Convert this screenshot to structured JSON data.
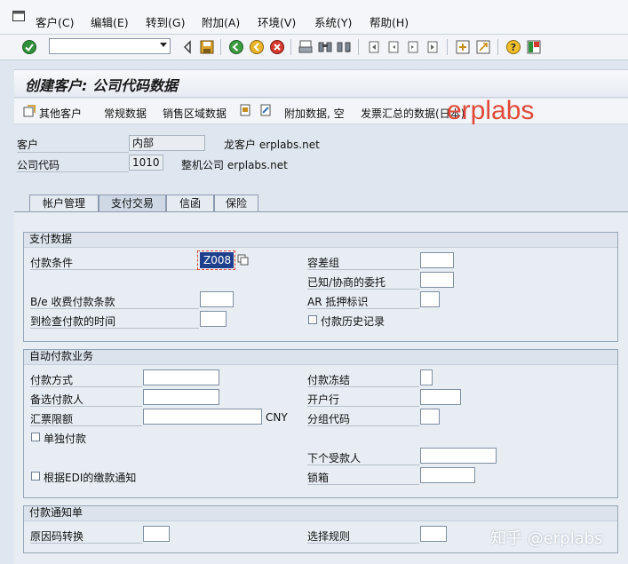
{
  "menubar": {
    "items": [
      "客户(C)",
      "编辑(E)",
      "转到(G)",
      "附加(A)",
      "环境(V)",
      "系统(Y)",
      "帮助(H)"
    ]
  },
  "screen": {
    "title": "创建客户: 公司代码数据"
  },
  "app_toolbar": {
    "other_customer": "其他客户",
    "general_data": "常规数据",
    "sales_area_data": "销售区域数据",
    "additional_data": "附加数据, 空",
    "invoice_summary": "发票汇总的数据(日本)"
  },
  "header": {
    "customer_label": "客户",
    "customer_value": "内部",
    "customer_desc": "龙客户 erplabs.net",
    "company_code_label": "公司代码",
    "company_code_value": "1010",
    "company_desc": "整机公司 erplabs.net"
  },
  "tabs": [
    "帐户管理",
    "支付交易",
    "信函",
    "保险"
  ],
  "payment_data": {
    "group_title": "支付数据",
    "payment_terms_label": "付款条件",
    "payment_terms_value": "Z008",
    "be_terms_label": "B/e 收费付款条款",
    "check_time_label": "到检查付款的时间",
    "tolerance_group_label": "容差组",
    "known_neg_leave_label": "已知/协商的委托",
    "ar_pledging_label": "AR 抵押标识",
    "payment_history_label": "付款历史记录"
  },
  "auto_payment": {
    "group_title": "自动付款业务",
    "payment_methods_label": "付款方式",
    "alt_payer_label": "备选付款人",
    "exchange_limit_label": "汇票限额",
    "currency": "CNY",
    "single_payment_label": "单独付款",
    "edi_advice_label": "根据EDI的缴款通知",
    "payment_block_label": "付款冻结",
    "house_bank_label": "开户行",
    "grouping_key_label": "分组代码",
    "next_payee_label": "下个受款人",
    "lockbox_label": "锁箱"
  },
  "payment_advice": {
    "group_title": "付款通知单",
    "reason_code_label": "原因码转换",
    "selection_rule_label": "选择规则"
  },
  "watermarks": {
    "brand": "erplabs",
    "zhihu": "知乎 @erplabs"
  },
  "colors": {
    "background": "#dfe6ef",
    "watermark": "#e14a3b"
  }
}
